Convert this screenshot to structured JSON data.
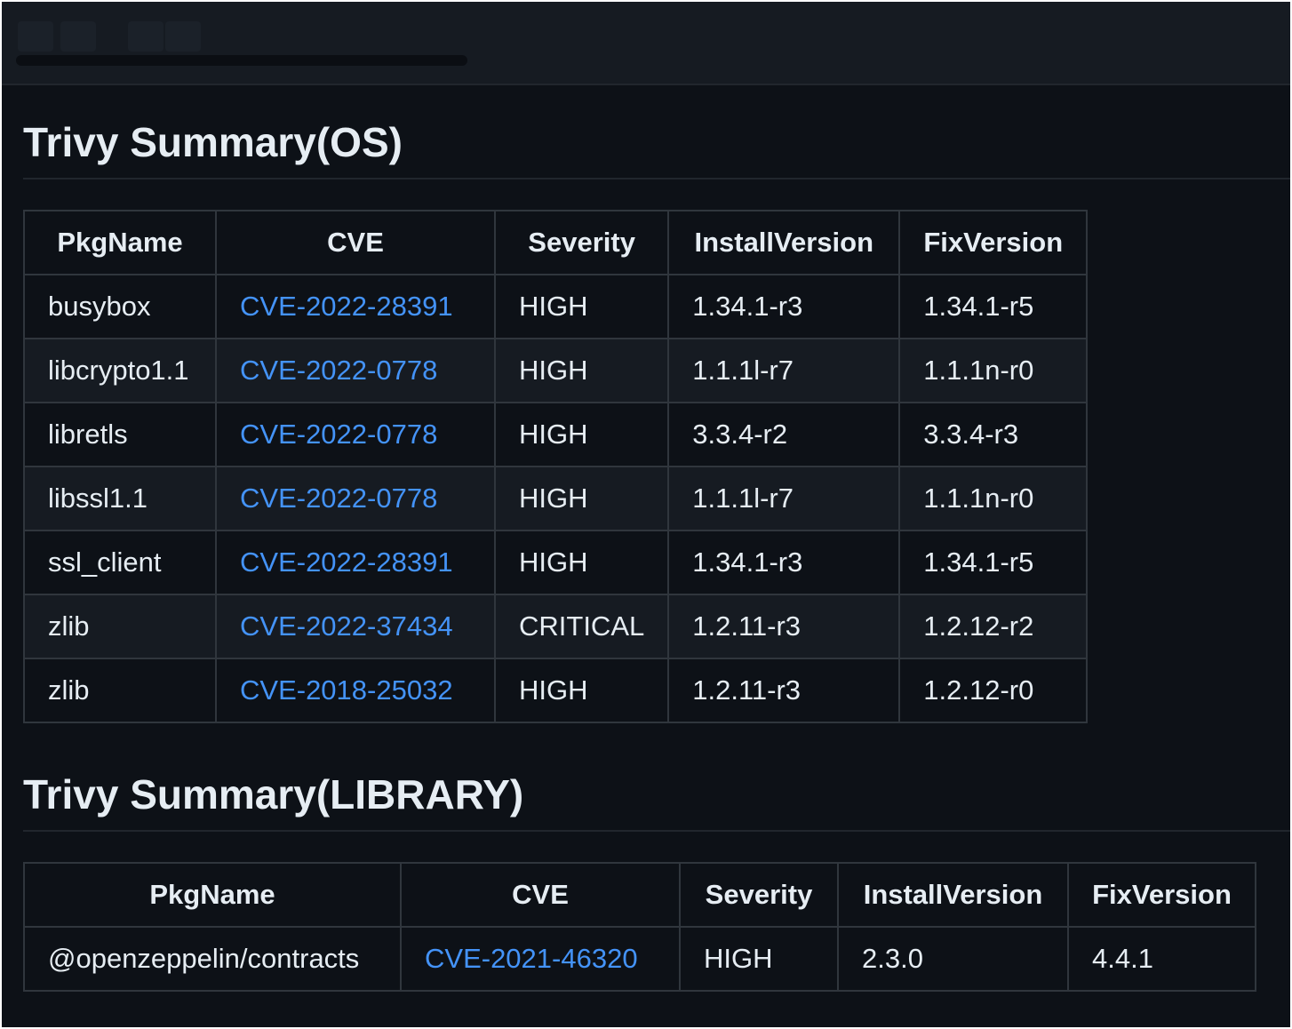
{
  "colors": {
    "background": "#0d1117",
    "text": "#e6edf3",
    "link": "#4493f8",
    "border": "#30363d"
  },
  "sections": [
    {
      "title": "Trivy Summary(OS)",
      "headers": [
        "PkgName",
        "CVE",
        "Severity",
        "InstallVersion",
        "FixVersion"
      ],
      "rows": [
        [
          "busybox",
          "CVE-2022-28391",
          "HIGH",
          "1.34.1-r3",
          "1.34.1-r5"
        ],
        [
          "libcrypto1.1",
          "CVE-2022-0778",
          "HIGH",
          "1.1.1l-r7",
          "1.1.1n-r0"
        ],
        [
          "libretls",
          "CVE-2022-0778",
          "HIGH",
          "3.3.4-r2",
          "3.3.4-r3"
        ],
        [
          "libssl1.1",
          "CVE-2022-0778",
          "HIGH",
          "1.1.1l-r7",
          "1.1.1n-r0"
        ],
        [
          "ssl_client",
          "CVE-2022-28391",
          "HIGH",
          "1.34.1-r3",
          "1.34.1-r5"
        ],
        [
          "zlib",
          "CVE-2022-37434",
          "CRITICAL",
          "1.2.11-r3",
          "1.2.12-r2"
        ],
        [
          "zlib",
          "CVE-2018-25032",
          "HIGH",
          "1.2.11-r3",
          "1.2.12-r0"
        ]
      ]
    },
    {
      "title": "Trivy Summary(LIBRARY)",
      "headers": [
        "PkgName",
        "CVE",
        "Severity",
        "InstallVersion",
        "FixVersion"
      ],
      "rows": [
        [
          "@openzeppelin/contracts",
          "CVE-2021-46320",
          "HIGH",
          "2.3.0",
          "4.4.1"
        ]
      ]
    }
  ]
}
